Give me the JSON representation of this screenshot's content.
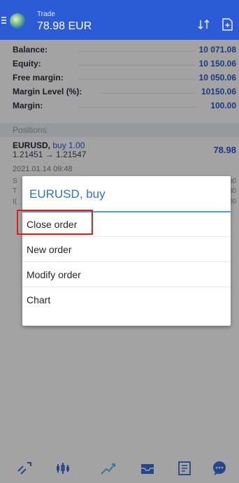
{
  "header": {
    "title": "Trade",
    "balance_value": "78.98 EUR",
    "sort_icon": "sort-icon",
    "document_icon": "document-plus-icon"
  },
  "summary": [
    {
      "label": "Balance:",
      "value": "10 071.08"
    },
    {
      "label": "Equity:",
      "value": "10 150.06"
    },
    {
      "label": "Free margin:",
      "value": "10 050.06"
    },
    {
      "label": "Margin Level (%):",
      "value": "10150.06"
    },
    {
      "label": "Margin:",
      "value": "100.00"
    }
  ],
  "positions": {
    "section_label": "Positions",
    "item": {
      "symbol": "EURUSD,",
      "side_volume": "buy 1.00",
      "prices": "1.21451 → 1.21547",
      "profit": "78.98",
      "datetime": "2021.01.14 09:48",
      "ghost_left": [
        "S",
        "T",
        "I("
      ],
      "ghost_right": [
        "00",
        "00",
        "00"
      ]
    }
  },
  "dialog": {
    "title": "EURUSD, buy",
    "items": [
      "Close order",
      "New order",
      "Modify order",
      "Chart"
    ]
  },
  "colors": {
    "header_bg": "#2c5bd6",
    "accent_blue": "#2b58d1",
    "highlight_red": "#e21b1b"
  },
  "nav": {
    "icons": [
      "quotes-icon",
      "chart-icon",
      "trade-icon",
      "history-icon",
      "news-icon",
      "chat-icon"
    ]
  }
}
